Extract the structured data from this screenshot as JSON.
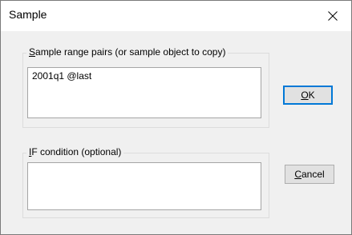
{
  "window": {
    "title": "Sample",
    "close_glyph": "✕"
  },
  "sample_group": {
    "label_accel": "S",
    "label_rest": "ample range pairs (or sample object to copy)",
    "value": "2001q1 @last"
  },
  "if_group": {
    "label_accel": "I",
    "label_rest": "F condition (optional)",
    "value": ""
  },
  "buttons": {
    "ok_accel": "O",
    "ok_rest": "K",
    "cancel_accel": "C",
    "cancel_rest": "ancel"
  },
  "colors": {
    "dialog_bg": "#f0f0f0",
    "titlebar_bg": "#ffffff",
    "default_button_border": "#0078d7"
  }
}
